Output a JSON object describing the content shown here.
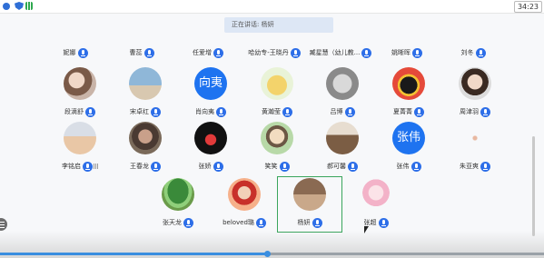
{
  "status_bar": {
    "time": "34:23"
  },
  "speaking": {
    "label": "正在讲话: 杨妍"
  },
  "header_row": [
    {
      "name": "妮娜"
    },
    {
      "name": "曹蕊"
    },
    {
      "name": "任爱增"
    },
    {
      "name": "哈幼专-王晓丹"
    },
    {
      "name": "臧星慧（幼儿教..."
    },
    {
      "name": "姚晰晖"
    },
    {
      "name": "刘冬"
    }
  ],
  "row1": [
    {
      "name": "段滴舒"
    },
    {
      "name": "宋卓红"
    },
    {
      "name": "肖向夷",
      "avatar_text": "向夷"
    },
    {
      "name": "黄瀚莹"
    },
    {
      "name": "吕博"
    },
    {
      "name": "夏菁菁"
    },
    {
      "name": "周津羽"
    }
  ],
  "row2": [
    {
      "name": "李铭启"
    },
    {
      "name": "王春龙"
    },
    {
      "name": "张娇"
    },
    {
      "name": "笑笑"
    },
    {
      "name": "郝可馨"
    },
    {
      "name": "张伟",
      "avatar_text": "张伟"
    },
    {
      "name": "朱亚爽"
    }
  ],
  "row3": [
    {
      "name": "张天龙"
    },
    {
      "name": "beloved璐"
    },
    {
      "name": "杨妍"
    },
    {
      "name": "张超"
    }
  ],
  "progress": {
    "value": 0.49
  },
  "icons": [
    "shield-icon",
    "signal-icon",
    "microphone-icon",
    "volume-icon",
    "menu-icon",
    "cursor-icon"
  ]
}
